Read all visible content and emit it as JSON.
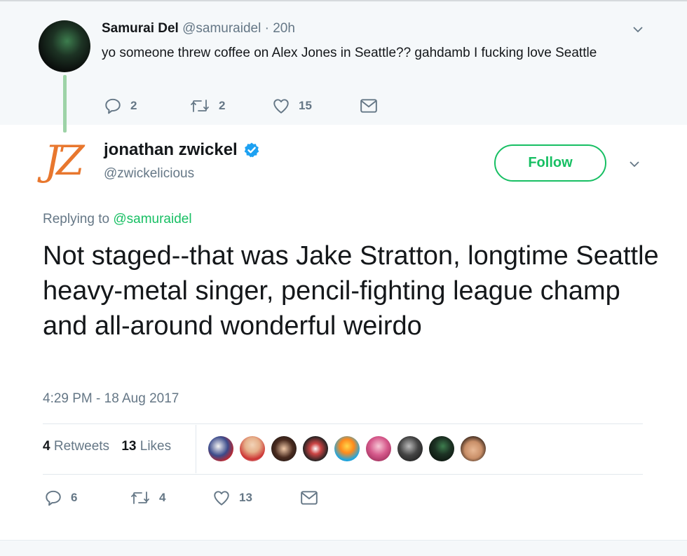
{
  "parent_tweet": {
    "name": "Samurai Del",
    "handle": "@samuraidel",
    "separator": "·",
    "time": "20h",
    "text": "yo someone threw coffee on Alex Jones in Seattle?? gahdamb I fucking love Seattle",
    "reply_count": "2",
    "retweet_count": "2",
    "like_count": "15"
  },
  "main_tweet": {
    "avatar_text": "JZ",
    "name": "jonathan zwickel",
    "handle": "@zwickelicious",
    "follow_label": "Follow",
    "replying_prefix": "Replying to",
    "replying_to": "@samuraidel",
    "text": "Not staged--that was Jake Stratton, longtime Seattle heavy-metal singer, pencil-fighting league champ and all-around wonderful weirdo",
    "timestamp": "4:29 PM - 18 Aug 2017",
    "retweets_count": "4",
    "retweets_label": "Retweets",
    "likes_count": "13",
    "likes_label": "Likes",
    "reply_count": "6",
    "retweet_count": "4",
    "like_count": "13"
  },
  "colors": {
    "accent_green": "#17bf63",
    "thread_line": "#9dd3a7",
    "verified_blue": "#1da1f2",
    "muted": "#657786",
    "avatar_orange": "#e8772e"
  }
}
